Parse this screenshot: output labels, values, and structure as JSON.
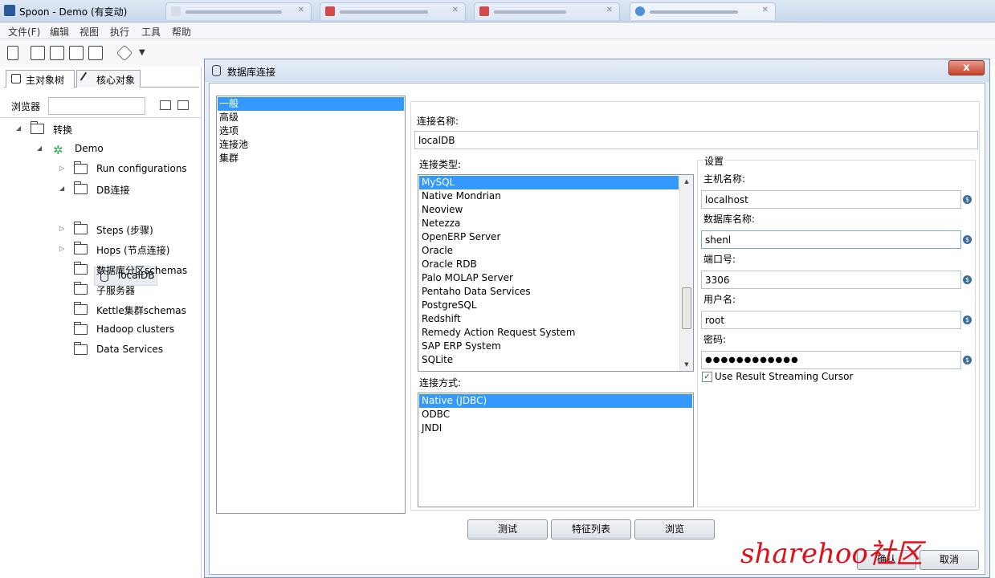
{
  "window": {
    "title": "Spoon - Demo (有变动)"
  },
  "menu": [
    "文件(F)",
    "编辑",
    "视图",
    "执行",
    "工具",
    "帮助"
  ],
  "left_panel": {
    "tabs": [
      "主对象树",
      "核心对象"
    ],
    "browser_label": "浏览器",
    "tree": [
      "转换",
      "Demo",
      "Run configurations",
      "DB连接",
      "localDB",
      "Steps (步骤)",
      "Hops (节点连接)",
      "数据库分区schemas",
      "子服务器",
      "Kettle集群schemas",
      "Hadoop clusters",
      "Data Services"
    ]
  },
  "dialog": {
    "title": "数据库连接",
    "close_label": "x",
    "nav_items": [
      "一般",
      "高级",
      "选项",
      "连接池",
      "集群"
    ],
    "connection_name_label": "连接名称:",
    "connection_name_value": "localDB",
    "connection_type_label": "连接类型:",
    "connection_types": [
      "MySQL",
      "Native Mondrian",
      "Neoview",
      "Netezza",
      "OpenERP Server",
      "Oracle",
      "Oracle RDB",
      "Palo MOLAP Server",
      "Pentaho Data Services",
      "PostgreSQL",
      "Redshift",
      "Remedy Action Request System",
      "SAP ERP System",
      "SQLite"
    ],
    "access_label": "连接方式:",
    "access_methods": [
      "Native (JDBC)",
      "ODBC",
      "JNDI"
    ],
    "settings": {
      "group_title": "设置",
      "host_label": "主机名称:",
      "host_value": "localhost",
      "db_label": "数据库名称:",
      "db_value": "shenl",
      "port_label": "端口号:",
      "port_value": "3306",
      "user_label": "用户名:",
      "user_value": "root",
      "password_label": "密码:",
      "password_value": "●●●●●●●●●●●●",
      "var_icon": "$",
      "streaming_label": "Use Result Streaming Cursor",
      "streaming_checked": "✓"
    },
    "buttons": {
      "test": "测试",
      "features": "特征列表",
      "explore": "浏览",
      "ok": "确认",
      "cancel": "取消"
    }
  },
  "watermark": "sharehoo社区",
  "colors": {
    "selection": "#3399ff",
    "close_button": "#c6432b",
    "watermark": "#e0101a"
  }
}
